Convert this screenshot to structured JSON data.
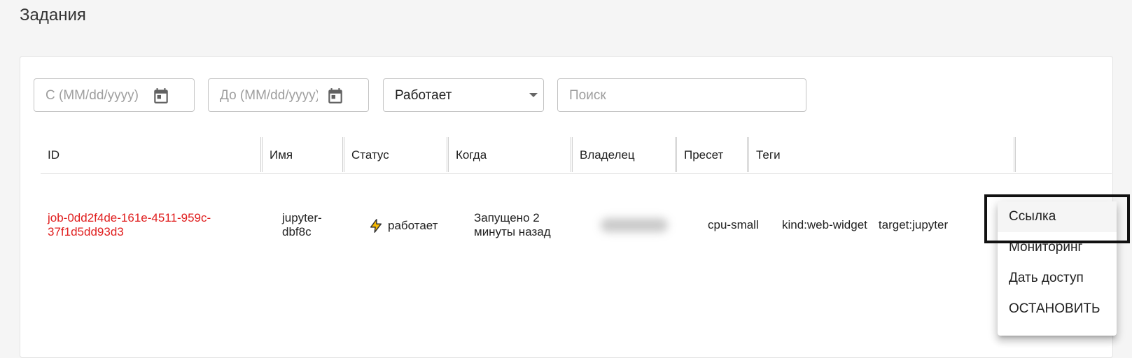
{
  "page": {
    "title": "Задания"
  },
  "filters": {
    "date_from_placeholder": "С (MM/dd/yyyy)",
    "date_to_placeholder": "До (MM/dd/yyyy)",
    "status_value": "Работает",
    "search_placeholder": "Поиск"
  },
  "table": {
    "columns": [
      "ID",
      "Имя",
      "Статус",
      "Когда",
      "Владелец",
      "Пресет",
      "Теги"
    ],
    "rows": [
      {
        "id_line1": "job-0dd2f4de-161e-4511-959c-",
        "id_line2": "37f1d5dd93d3",
        "name_line1": "jupyter-",
        "name_line2": "dbf8c",
        "status": "работает",
        "when_line1": "Запущено 2",
        "when_line2": "минуты назад",
        "preset": "cpu-small",
        "tags": [
          "kind:web-widget",
          "target:jupyter"
        ]
      }
    ]
  },
  "menu": {
    "items": [
      "Ссылка",
      "Мониторинг",
      "Дать доступ",
      "ОСТАНОВИТЬ"
    ]
  },
  "colors": {
    "accent": "#e01e1e",
    "bolt": "#f5b800"
  },
  "icons": [
    "calendar-icon",
    "chevron-down-icon",
    "lightning-icon"
  ]
}
